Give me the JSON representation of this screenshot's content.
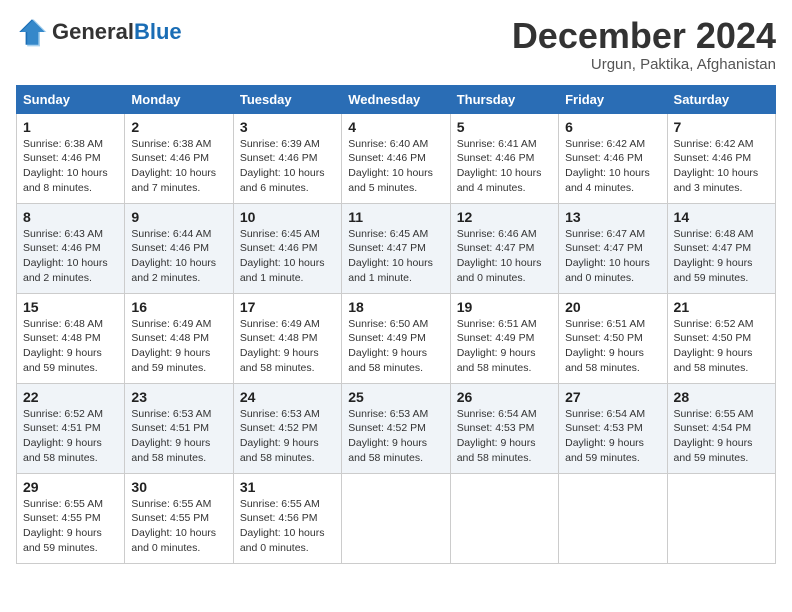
{
  "header": {
    "logo_general": "General",
    "logo_blue": "Blue",
    "month_title": "December 2024",
    "subtitle": "Urgun, Paktika, Afghanistan"
  },
  "days_of_week": [
    "Sunday",
    "Monday",
    "Tuesday",
    "Wednesday",
    "Thursday",
    "Friday",
    "Saturday"
  ],
  "weeks": [
    [
      {
        "num": "1",
        "info": "Sunrise: 6:38 AM\nSunset: 4:46 PM\nDaylight: 10 hours and 8 minutes."
      },
      {
        "num": "2",
        "info": "Sunrise: 6:38 AM\nSunset: 4:46 PM\nDaylight: 10 hours and 7 minutes."
      },
      {
        "num": "3",
        "info": "Sunrise: 6:39 AM\nSunset: 4:46 PM\nDaylight: 10 hours and 6 minutes."
      },
      {
        "num": "4",
        "info": "Sunrise: 6:40 AM\nSunset: 4:46 PM\nDaylight: 10 hours and 5 minutes."
      },
      {
        "num": "5",
        "info": "Sunrise: 6:41 AM\nSunset: 4:46 PM\nDaylight: 10 hours and 4 minutes."
      },
      {
        "num": "6",
        "info": "Sunrise: 6:42 AM\nSunset: 4:46 PM\nDaylight: 10 hours and 4 minutes."
      },
      {
        "num": "7",
        "info": "Sunrise: 6:42 AM\nSunset: 4:46 PM\nDaylight: 10 hours and 3 minutes."
      }
    ],
    [
      {
        "num": "8",
        "info": "Sunrise: 6:43 AM\nSunset: 4:46 PM\nDaylight: 10 hours and 2 minutes."
      },
      {
        "num": "9",
        "info": "Sunrise: 6:44 AM\nSunset: 4:46 PM\nDaylight: 10 hours and 2 minutes."
      },
      {
        "num": "10",
        "info": "Sunrise: 6:45 AM\nSunset: 4:46 PM\nDaylight: 10 hours and 1 minute."
      },
      {
        "num": "11",
        "info": "Sunrise: 6:45 AM\nSunset: 4:47 PM\nDaylight: 10 hours and 1 minute."
      },
      {
        "num": "12",
        "info": "Sunrise: 6:46 AM\nSunset: 4:47 PM\nDaylight: 10 hours and 0 minutes."
      },
      {
        "num": "13",
        "info": "Sunrise: 6:47 AM\nSunset: 4:47 PM\nDaylight: 10 hours and 0 minutes."
      },
      {
        "num": "14",
        "info": "Sunrise: 6:48 AM\nSunset: 4:47 PM\nDaylight: 9 hours and 59 minutes."
      }
    ],
    [
      {
        "num": "15",
        "info": "Sunrise: 6:48 AM\nSunset: 4:48 PM\nDaylight: 9 hours and 59 minutes."
      },
      {
        "num": "16",
        "info": "Sunrise: 6:49 AM\nSunset: 4:48 PM\nDaylight: 9 hours and 59 minutes."
      },
      {
        "num": "17",
        "info": "Sunrise: 6:49 AM\nSunset: 4:48 PM\nDaylight: 9 hours and 58 minutes."
      },
      {
        "num": "18",
        "info": "Sunrise: 6:50 AM\nSunset: 4:49 PM\nDaylight: 9 hours and 58 minutes."
      },
      {
        "num": "19",
        "info": "Sunrise: 6:51 AM\nSunset: 4:49 PM\nDaylight: 9 hours and 58 minutes."
      },
      {
        "num": "20",
        "info": "Sunrise: 6:51 AM\nSunset: 4:50 PM\nDaylight: 9 hours and 58 minutes."
      },
      {
        "num": "21",
        "info": "Sunrise: 6:52 AM\nSunset: 4:50 PM\nDaylight: 9 hours and 58 minutes."
      }
    ],
    [
      {
        "num": "22",
        "info": "Sunrise: 6:52 AM\nSunset: 4:51 PM\nDaylight: 9 hours and 58 minutes."
      },
      {
        "num": "23",
        "info": "Sunrise: 6:53 AM\nSunset: 4:51 PM\nDaylight: 9 hours and 58 minutes."
      },
      {
        "num": "24",
        "info": "Sunrise: 6:53 AM\nSunset: 4:52 PM\nDaylight: 9 hours and 58 minutes."
      },
      {
        "num": "25",
        "info": "Sunrise: 6:53 AM\nSunset: 4:52 PM\nDaylight: 9 hours and 58 minutes."
      },
      {
        "num": "26",
        "info": "Sunrise: 6:54 AM\nSunset: 4:53 PM\nDaylight: 9 hours and 58 minutes."
      },
      {
        "num": "27",
        "info": "Sunrise: 6:54 AM\nSunset: 4:53 PM\nDaylight: 9 hours and 59 minutes."
      },
      {
        "num": "28",
        "info": "Sunrise: 6:55 AM\nSunset: 4:54 PM\nDaylight: 9 hours and 59 minutes."
      }
    ],
    [
      {
        "num": "29",
        "info": "Sunrise: 6:55 AM\nSunset: 4:55 PM\nDaylight: 9 hours and 59 minutes."
      },
      {
        "num": "30",
        "info": "Sunrise: 6:55 AM\nSunset: 4:55 PM\nDaylight: 10 hours and 0 minutes."
      },
      {
        "num": "31",
        "info": "Sunrise: 6:55 AM\nSunset: 4:56 PM\nDaylight: 10 hours and 0 minutes."
      },
      null,
      null,
      null,
      null
    ]
  ]
}
